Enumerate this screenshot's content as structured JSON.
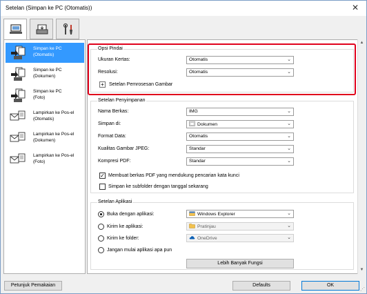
{
  "window": {
    "title": "Setelan (Simpan ke PC (Otomatis))",
    "close_glyph": "✕"
  },
  "top_tabs": [
    {
      "icon": "computer-scan-icon"
    },
    {
      "icon": "scanner-icon"
    },
    {
      "icon": "tools-icon"
    }
  ],
  "sidebar": {
    "items": [
      {
        "line1": "Simpan ke PC",
        "line2": "(Otomatis)",
        "selected": true,
        "icon": "save-to-pc-icon"
      },
      {
        "line1": "Simpan ke PC",
        "line2": "(Dokumen)",
        "selected": false,
        "icon": "save-to-pc-icon"
      },
      {
        "line1": "Simpan ke PC",
        "line2": "(Foto)",
        "selected": false,
        "icon": "save-to-pc-icon"
      },
      {
        "line1": "Lampirkan ke Pos-el",
        "line2": "(Otomatis)",
        "selected": false,
        "icon": "attach-email-icon"
      },
      {
        "line1": "Lampirkan ke Pos-el",
        "line2": "(Dokumen)",
        "selected": false,
        "icon": "attach-email-icon"
      },
      {
        "line1": "Lampirkan ke Pos-el",
        "line2": "(Foto)",
        "selected": false,
        "icon": "attach-email-icon"
      }
    ]
  },
  "scan_options": {
    "title": "Opsi Pindai",
    "paper_size_label": "Ukuran Kertas:",
    "paper_size_value": "Otomatis",
    "resolution_label": "Resolusi:",
    "resolution_value": "Otomatis",
    "image_processing_label": "Setelan Pemrosesan Gambar"
  },
  "save_settings": {
    "title": "Setelan Penyimpanan",
    "file_name_label": "Nama Berkas:",
    "file_name_value": "IMG",
    "save_in_label": "Simpan di:",
    "save_in_value": "Dokumen",
    "data_format_label": "Format Data:",
    "data_format_value": "Otomatis",
    "jpeg_quality_label": "Kualitas Gambar JPEG:",
    "jpeg_quality_value": "Standar",
    "pdf_compression_label": "Kompresi PDF:",
    "pdf_compression_value": "Standar",
    "searchable_pdf_label": "Membuat berkas PDF yang mendukung pencarian kata kunci",
    "searchable_pdf_checked": true,
    "subfolder_label": "Simpan ke subfolder dengan tanggal sekarang",
    "subfolder_checked": false,
    "checkmark": "✓"
  },
  "app_settings": {
    "title": "Setelan Aplikasi",
    "open_app_label": "Buka dengan aplikasi:",
    "open_app_value": "Windows Explorer",
    "send_app_label": "Kirim ke aplikasi:",
    "send_app_value": "Pratinjau",
    "send_folder_label": "Kirim ke folder:",
    "send_folder_value": "OneDrive",
    "no_app_label": "Jangan mulai aplikasi apa pun",
    "selected_option": "open_app",
    "more_functions_label": "Lebih Banyak Fungsi"
  },
  "footer": {
    "instructions_label": "Petunjuk Pemakaian",
    "defaults_label": "Defaults",
    "ok_label": "OK"
  },
  "colors": {
    "selection": "#3399ff",
    "highlight_border": "#e0001b",
    "accent": "#0078d7"
  }
}
